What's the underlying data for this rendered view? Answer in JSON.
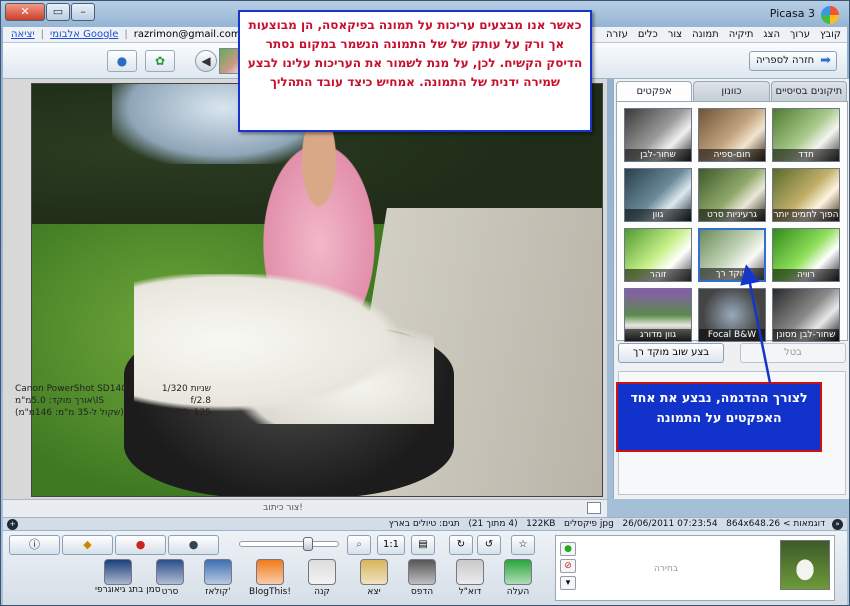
{
  "window": {
    "title": "Picasa 3",
    "buttons": {
      "close": "✕",
      "maximize": "▭",
      "minimize": "–"
    }
  },
  "menu": [
    "קובץ",
    "ערוך",
    "הצג",
    "תיקיה",
    "תמונה",
    "צור",
    "כלים",
    "עזרה"
  ],
  "account": {
    "email": "razrimon@gmail.com",
    "albums_link": "אלבומי Google",
    "logout_link": "יציאה",
    "separator": "|"
  },
  "toolbar": {
    "back_to_library": "חזרה לספריה"
  },
  "tabs": [
    "תיקונים בסיסיים",
    "כוונון",
    "אפקטים"
  ],
  "active_tab": 2,
  "effects": [
    {
      "label": "חדד"
    },
    {
      "label": "חום-ספיה"
    },
    {
      "label": "שחור-לבן"
    },
    {
      "label": "הפוך לחמים יותר"
    },
    {
      "label": "גרעיניות סרט"
    },
    {
      "label": "גוון"
    },
    {
      "label": "רוויה"
    },
    {
      "label": "מוקד רך"
    },
    {
      "label": "זוהר"
    },
    {
      "label": "שחור-לבן מסונן"
    },
    {
      "label": "Focal B&W"
    },
    {
      "label": "גוון מדורג"
    }
  ],
  "selected_effect": 7,
  "controls": {
    "undo": "בטל",
    "apply": "בצע שוב מוקד רך"
  },
  "exif": {
    "shutter_label": "1/320 שניות",
    "camera": "Canon PowerShot SD1400",
    "aperture": "f/2.8",
    "focal": "אורך מוקד: 5.0מ\"מ\\IS",
    "iso": "ISO: 125",
    "equiv": "(שקול ל-35 מ\"מ: 146מ\"מ)"
  },
  "caption": {
    "placeholder": "צור כיתוב!"
  },
  "status": {
    "path": "דוגמאות > 26.jpg",
    "date": "26/06/2011 07:23:54",
    "dims": "864x648 פיקסלים",
    "size": "122KB",
    "position": "(4 מתוך 21)",
    "tags": "תגים: טיולים בארץ"
  },
  "actions": [
    {
      "key": "upload",
      "label": "העלה",
      "color": "#2aa53c"
    },
    {
      "key": "email",
      "label": "דוא\"ל",
      "color": "#c9c9c9"
    },
    {
      "key": "print",
      "label": "הדפס",
      "color": "#555"
    },
    {
      "key": "export",
      "label": "יצא",
      "color": "#d8b45a"
    },
    {
      "key": "shop",
      "label": "קנה",
      "color": "#ddd"
    },
    {
      "key": "blog",
      "label": "BlogThis!",
      "color": "#f07a1a"
    },
    {
      "key": "collage",
      "label": "קולאז'",
      "color": "#3d6fb0"
    },
    {
      "key": "movie",
      "label": "סרט",
      "color": "#2b4f8a"
    },
    {
      "key": "geotag",
      "label": "סמן בתג גיאוגרפי",
      "color": "#1a3f7a"
    }
  ],
  "tray": {
    "selection_label": "בחירה"
  },
  "zoom": 0.7,
  "notes": {
    "top": "כאשר אנו מבצעים עריכות על תמונה בפיקאסה, הן מבוצעות אך ורק על עותק של של התמונה הנשמר במקום נסתר הדיסק הקשיח. לכן, על מנת לשמור את העריכות עלינו לבצע שמירה ידנית של התמונה. אמחיש כיצד עובד התהליך",
    "bottom": "לצורך ההדגמה, נבצע את אחד האפקטים על התמונה"
  },
  "colors": {
    "note_text": "#c8102e",
    "note_border": "#1736c9",
    "note2_bg": "#1133cc",
    "note2_border": "#cc1111",
    "link": "#1a4fd1"
  }
}
